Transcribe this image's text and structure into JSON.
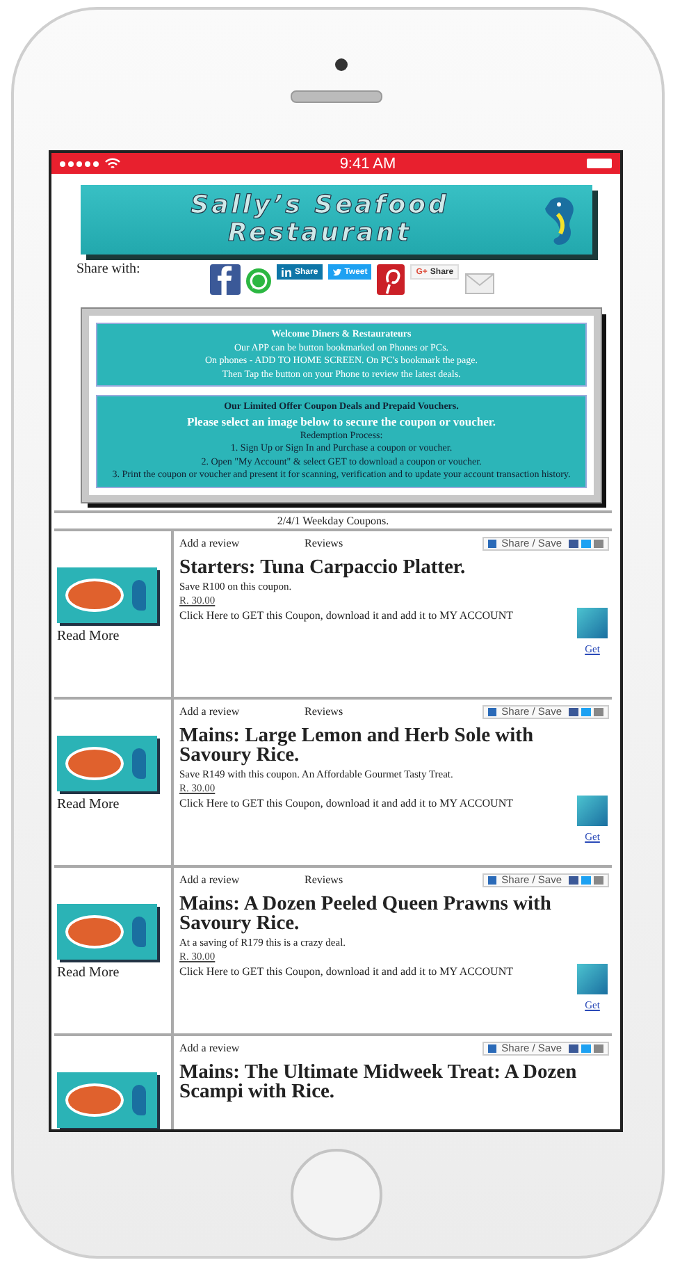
{
  "status_bar": {
    "time": "9:41 AM"
  },
  "banner": {
    "line_1": "Sally’s Seafood",
    "line_2": "Restaurant"
  },
  "share": {
    "label": "Share with:",
    "buttons": [
      {
        "kind": "facebook"
      },
      {
        "kind": "whatsapp"
      },
      {
        "kind": "linkedin",
        "logo": "in",
        "label": "Share"
      },
      {
        "kind": "twitter",
        "label": "Tweet"
      },
      {
        "kind": "pinterest"
      },
      {
        "kind": "google",
        "logo": "G+",
        "label": "Share"
      },
      {
        "kind": "email"
      }
    ]
  },
  "notice_boxes": [
    {
      "lines": [
        {
          "kind": "bold-light",
          "text": "Welcome Diners & Restaurateurs"
        },
        {
          "kind": "light",
          "text": "Our APP can be button bookmarked on Phones or PCs."
        },
        {
          "kind": "light",
          "text": "On phones - ADD TO HOME SCREEN.  On PC's bookmark the page."
        },
        {
          "kind": "light",
          "text": "Then Tap the button on your Phone to review the latest deals."
        }
      ]
    },
    {
      "lines": [
        {
          "kind": "bold-dark",
          "text": "Our Limited Offer Coupon Deals and Prepaid Vouchers."
        },
        {
          "kind": "big-light",
          "text": "Please select an image below to secure the coupon or voucher."
        },
        {
          "kind": "dark",
          "text": "Redemption Process:"
        },
        {
          "kind": "dark",
          "text": "1. Sign Up or Sign In and Purchase a coupon or voucher."
        },
        {
          "kind": "dark",
          "text": "2. Open \"My Account\" & select GET to download a coupon or voucher."
        },
        {
          "kind": "dark",
          "text": "3. Print the coupon or voucher and present it for scanning, verification and to update your account transaction history."
        }
      ]
    }
  ],
  "coupons": {
    "heading": "2/4/1 Weekday Coupons.",
    "items": [
      {
        "read_more": "Read More",
        "add_review": "Add a review",
        "reviews": "Reviews",
        "share_label": "Share / Save",
        "title": "Starters: Tuna Carpaccio Platter.",
        "note": "Save R100 on this coupon.",
        "price": "R. 30.00",
        "get_text": "Click Here to GET this Coupon, download it and add it to MY ACCOUNT",
        "get_label": "Get"
      },
      {
        "read_more": "Read More",
        "add_review": "Add a review",
        "reviews": "Reviews",
        "share_label": "Share / Save",
        "title": "Mains: Large Lemon and Herb Sole with Savoury Rice.",
        "note": "Save R149 with this coupon. An Affordable Gourmet Tasty Treat.",
        "price": "R. 30.00",
        "get_text": "Click Here to GET this Coupon, download it and add it to MY ACCOUNT",
        "get_label": "Get"
      },
      {
        "read_more": "Read More",
        "add_review": "Add a review",
        "reviews": "Reviews",
        "share_label": "Share / Save",
        "title": "Mains: A Dozen Peeled Queen Prawns with Savoury Rice.",
        "note": "At a saving of R179 this is a crazy deal.",
        "price": "R. 30.00",
        "get_text": "Click Here to GET this Coupon, download it and add it to MY ACCOUNT",
        "get_label": "Get"
      },
      {
        "add_review": "Add a review",
        "share_label": "Share / Save",
        "title": "Mains: The Ultimate Midweek Treat: A Dozen Scampi with Rice."
      }
    ]
  }
}
